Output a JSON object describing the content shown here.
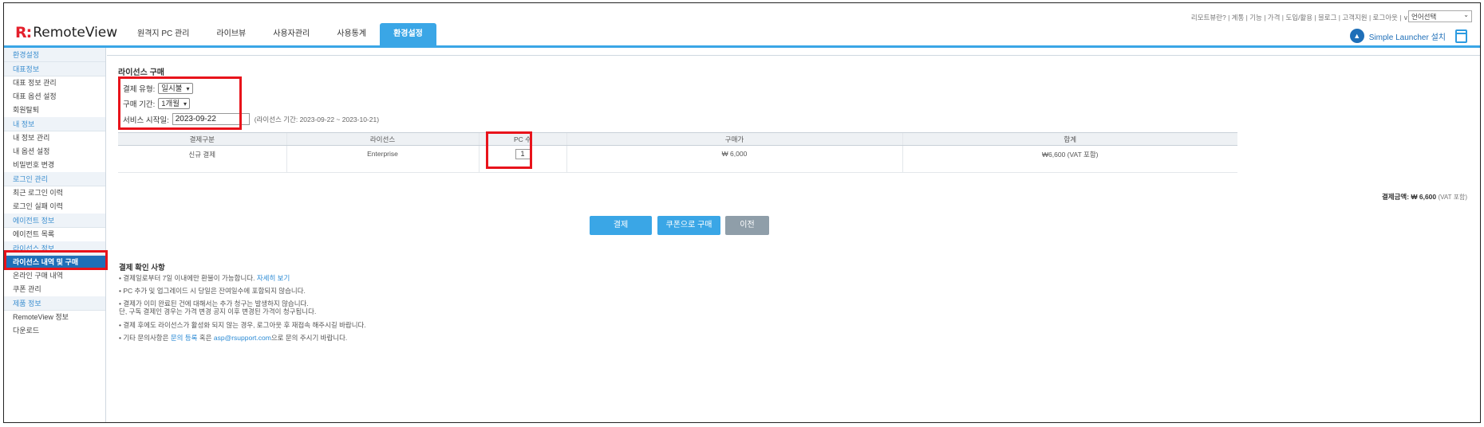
{
  "header": {
    "logo_mark": "R:",
    "logo_text": "RemoteView",
    "tabs": [
      {
        "label": "원격지 PC 관리"
      },
      {
        "label": "라이브뷰"
      },
      {
        "label": "사용자관리"
      },
      {
        "label": "사용통계"
      },
      {
        "label": "환경설정",
        "active": true
      }
    ],
    "top_links": "리모트뷰란? | 계통 | 기능 | 가격 | 도입/활용 | 블로그 | 고객지원 | 로그아웃 | ∨",
    "language_select": "언어선택",
    "launcher_label": "Simple Launcher 설치",
    "accent_color": "#3aa6e6"
  },
  "sidebar": {
    "items": [
      {
        "type": "group",
        "label": "환경설정"
      },
      {
        "type": "group",
        "label": "대표정보"
      },
      {
        "type": "item",
        "label": "대표 정보 관리"
      },
      {
        "type": "item",
        "label": "대표 옵션 설정"
      },
      {
        "type": "item",
        "label": "회원탈퇴"
      },
      {
        "type": "group",
        "label": "내 정보"
      },
      {
        "type": "item",
        "label": "내 정보 관리"
      },
      {
        "type": "item",
        "label": "내 옵션 설정"
      },
      {
        "type": "item",
        "label": "비밀번호 변경"
      },
      {
        "type": "group",
        "label": "로그인 관리"
      },
      {
        "type": "item",
        "label": "최근 로그인 이력"
      },
      {
        "type": "item",
        "label": "로그인 실패 이력"
      },
      {
        "type": "group",
        "label": "에이전트 정보"
      },
      {
        "type": "item",
        "label": "에이전트 목록"
      },
      {
        "type": "group",
        "label": "라이선스 정보"
      },
      {
        "type": "item",
        "label": "라이선스 내역 및 구매",
        "active": true
      },
      {
        "type": "item",
        "label": "온라인 구매 내역"
      },
      {
        "type": "item",
        "label": "쿠폰 관리"
      },
      {
        "type": "group",
        "label": "제품 정보"
      },
      {
        "type": "item",
        "label": "RemoteView 정보"
      },
      {
        "type": "item",
        "label": "다운로드"
      }
    ]
  },
  "main": {
    "section_title": "라이선스 구매",
    "form": {
      "payment_type_label": "결제 유형:",
      "payment_type_value": "일시불",
      "period_label": "구매 기간:",
      "period_value": "1개월",
      "start_label": "서비스 시작일:",
      "start_value": "2023-09-22",
      "license_period_note": "(라이선스 기간: 2023-09-22 ~ 2023-10-21)"
    },
    "table": {
      "headers": [
        "결제구분",
        "라이선스",
        "PC 수",
        "구매가",
        "합계"
      ],
      "row": {
        "type": "신규 결제",
        "license": "Enterprise",
        "pc_count": "1",
        "price": "₩ 6,000",
        "total": "₩6,600 (VAT 포함)"
      }
    },
    "total": {
      "label": "결제금액:",
      "value": "₩ 6,600",
      "vat": "(VAT 포함)"
    },
    "buttons": {
      "pay": "결제",
      "coupon": "쿠폰으로 구매",
      "prev": "이전"
    },
    "notice": {
      "title": "결제 확인 사항",
      "line1_text": "• 결제일로부터 7일 이내에만 환불이 가능합니다.",
      "line1_link": "자세히 보기",
      "line2": "• PC 추가 및 업그레이드 시 당일은 잔여일수에 포함되지 않습니다.",
      "line3a": "• 결제가 이미 완료된 건에 대해서는 추가 청구는 발생하지 않습니다.",
      "line3b": "  단, 구독 결제인 경우는 가격 변경 공지 이후 변경된 가격이 청구됩니다.",
      "line4": "• 결제 후에도 라이선스가 활성화 되지 않는 경우, 로그아웃 후 재접속 해주시길 바랍니다.",
      "line5_pre": "• 기타 문의사항은",
      "line5_link1": "문의 등록",
      "line5_mid": "혹은",
      "line5_link2": "asp@rsupport.com",
      "line5_post": "으로 문의 주시기 바랍니다."
    }
  }
}
